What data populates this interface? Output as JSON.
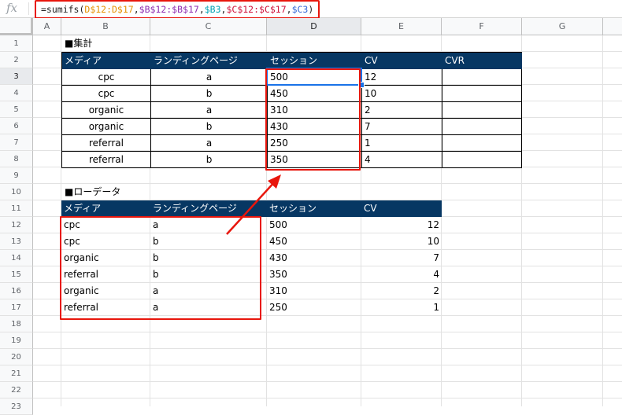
{
  "formula_bar": {
    "fx": "fx",
    "parts": [
      "=sumifs(",
      "D$12:D$17",
      ",",
      "$B$12:$B$17",
      ",",
      "$B3",
      ",",
      "$C$12:$C$17",
      ",",
      "$C3",
      ")"
    ]
  },
  "columns": [
    "A",
    "B",
    "C",
    "D",
    "E",
    "F",
    "G"
  ],
  "rows": [
    "1",
    "2",
    "3",
    "4",
    "5",
    "6",
    "7",
    "8",
    "9",
    "10",
    "11",
    "12",
    "13",
    "14",
    "15",
    "16",
    "17",
    "18",
    "19",
    "20",
    "21",
    "22",
    "23"
  ],
  "summary": {
    "title": "■集計",
    "headers": [
      "メディア",
      "ランディングページ",
      "セッション",
      "CV",
      "CVR"
    ],
    "rows": [
      [
        "cpc",
        "a",
        "500",
        "12",
        ""
      ],
      [
        "cpc",
        "b",
        "450",
        "10",
        ""
      ],
      [
        "organic",
        "a",
        "310",
        "2",
        ""
      ],
      [
        "organic",
        "b",
        "430",
        "7",
        ""
      ],
      [
        "referral",
        "a",
        "250",
        "1",
        ""
      ],
      [
        "referral",
        "b",
        "350",
        "4",
        ""
      ]
    ]
  },
  "raw": {
    "title": "■ローデータ",
    "headers": [
      "メディア",
      "ランディングページ",
      "セッション",
      "CV"
    ],
    "rows": [
      [
        "cpc",
        "a",
        "500",
        "12"
      ],
      [
        "cpc",
        "b",
        "450",
        "10"
      ],
      [
        "organic",
        "b",
        "430",
        "7"
      ],
      [
        "referral",
        "b",
        "350",
        "4"
      ],
      [
        "organic",
        "a",
        "310",
        "2"
      ],
      [
        "referral",
        "a",
        "250",
        "1"
      ]
    ]
  },
  "colors": {
    "header_bg": "#073763",
    "highlight_red": "#e8160c",
    "selection_blue": "#1a73e8"
  }
}
